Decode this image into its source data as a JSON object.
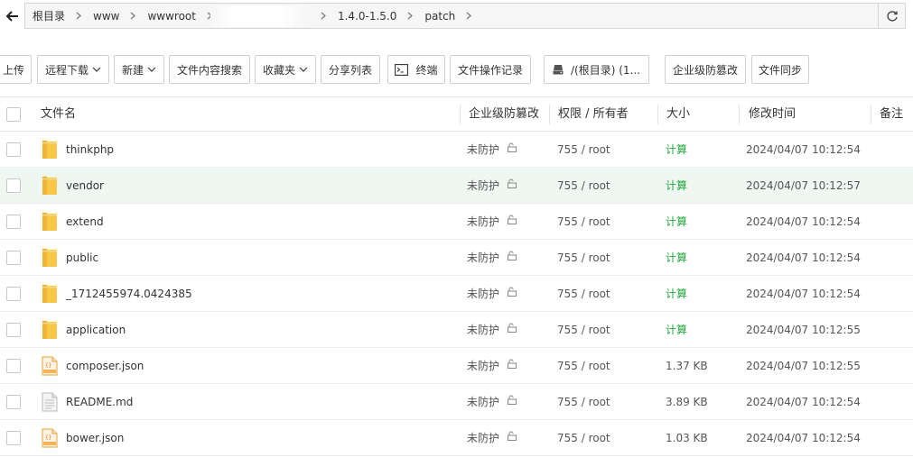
{
  "pathbar": {
    "crumbs": [
      "根目录",
      "www",
      "wwwroot",
      "",
      "1.4.0-1.5.0",
      "patch"
    ]
  },
  "toolbar": {
    "upload": "上传",
    "remote_download": "远程下载",
    "new": "新建",
    "content_search": "文件内容搜索",
    "favorites": "收藏夹",
    "share_list": "分享列表",
    "terminal": "终端",
    "op_log": "文件操作记录",
    "disk": "/(根目录) (1...",
    "tamper": "企业级防篡改",
    "sync": "文件同步"
  },
  "table": {
    "headers": {
      "name": "文件名",
      "tamper": "企业级防篡改",
      "perm": "权限 / 所有者",
      "size": "大小",
      "mtime": "修改时间",
      "note": "备注"
    },
    "rows": [
      {
        "name": "thinkphp",
        "icon": "folder-icon",
        "tamper": "未防护",
        "perm": "755 / root",
        "size": "计算",
        "mtime": "2024/04/07 10:12:54"
      },
      {
        "name": "vendor",
        "icon": "folder-icon",
        "tamper": "未防护",
        "perm": "755 / root",
        "size": "计算",
        "mtime": "2024/04/07 10:12:57"
      },
      {
        "name": "extend",
        "icon": "folder-icon",
        "tamper": "未防护",
        "perm": "755 / root",
        "size": "计算",
        "mtime": "2024/04/07 10:12:54"
      },
      {
        "name": "public",
        "icon": "folder-icon",
        "tamper": "未防护",
        "perm": "755 / root",
        "size": "计算",
        "mtime": "2024/04/07 10:12:54"
      },
      {
        "name": "_1712455974.0424385",
        "icon": "folder-icon",
        "tamper": "未防护",
        "perm": "755 / root",
        "size": "计算",
        "mtime": "2024/04/07 10:12:54"
      },
      {
        "name": "application",
        "icon": "folder-icon",
        "tamper": "未防护",
        "perm": "755 / root",
        "size": "计算",
        "mtime": "2024/04/07 10:12:55"
      },
      {
        "name": "composer.json",
        "icon": "json-file-icon",
        "tamper": "未防护",
        "perm": "755 / root",
        "size": "1.37 KB",
        "mtime": "2024/04/07 10:12:55"
      },
      {
        "name": "README.md",
        "icon": "text-file-icon",
        "tamper": "未防护",
        "perm": "755 / root",
        "size": "3.89 KB",
        "mtime": "2024/04/07 10:12:54"
      },
      {
        "name": "bower.json",
        "icon": "json-file-icon",
        "tamper": "未防护",
        "perm": "755 / root",
        "size": "1.03 KB",
        "mtime": "2024/04/07 10:12:54"
      }
    ]
  },
  "colors": {
    "calc_green": "#20a53a",
    "hover_row": "#eef7f2",
    "folder_yellow": "#f7c748",
    "json_orange": "#e9a23b"
  }
}
